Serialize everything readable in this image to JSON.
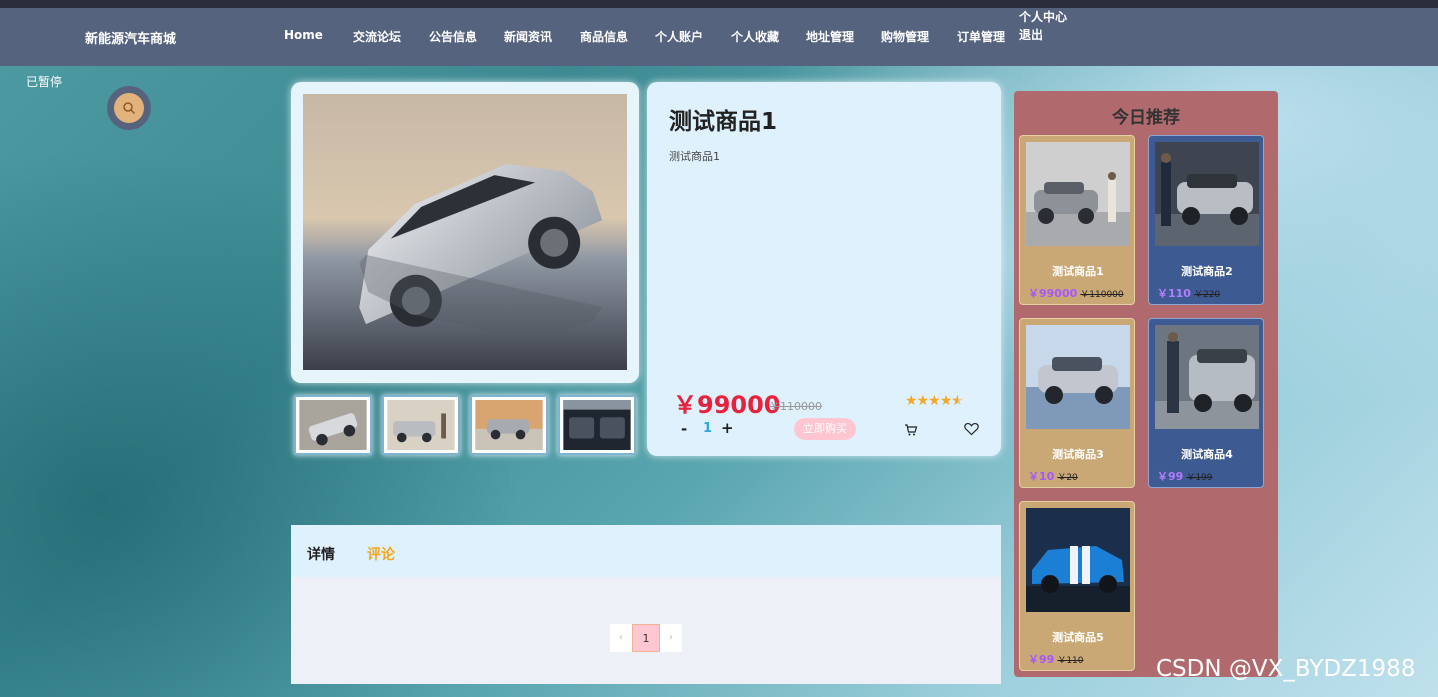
{
  "site": {
    "brand": "新能源汽车商城"
  },
  "nav": {
    "items": [
      "Home",
      "交流论坛",
      "公告信息",
      "新闻资讯",
      "商品信息",
      "个人账户",
      "个人收藏",
      "地址管理",
      "购物管理",
      "订单管理"
    ],
    "personal_center": "个人中心",
    "logout": "退出"
  },
  "overlay": {
    "paused": "已暂停"
  },
  "product": {
    "title": "测试商品1",
    "subtitle": "测试商品1",
    "price": "￥99000",
    "old_price": "￥110000",
    "rating": 4.5,
    "quantity": "1",
    "minus": "-",
    "plus": "+",
    "buy_label": "立即购买"
  },
  "recommend": {
    "title": "今日推荐",
    "items": [
      {
        "name": "测试商品1",
        "price": "￥99000",
        "old_price": "￥110000"
      },
      {
        "name": "测试商品2",
        "price": "￥110",
        "old_price": "￥220"
      },
      {
        "name": "测试商品3",
        "price": "￥10",
        "old_price": "￥20"
      },
      {
        "name": "测试商品4",
        "price": "￥99",
        "old_price": "￥199"
      },
      {
        "name": "测试商品5",
        "price": "￥99",
        "old_price": "￥110"
      }
    ]
  },
  "detail": {
    "tab_detail": "详情",
    "tab_comment": "评论",
    "pager": {
      "prev": "‹",
      "current": "1",
      "next": "›"
    }
  },
  "watermark": "CSDN @VX_BYDZ1988",
  "colors": {
    "navbar": "#56637e",
    "price": "#e6223c",
    "accent": "#f0a81e",
    "buy": "#ffc6d2"
  }
}
